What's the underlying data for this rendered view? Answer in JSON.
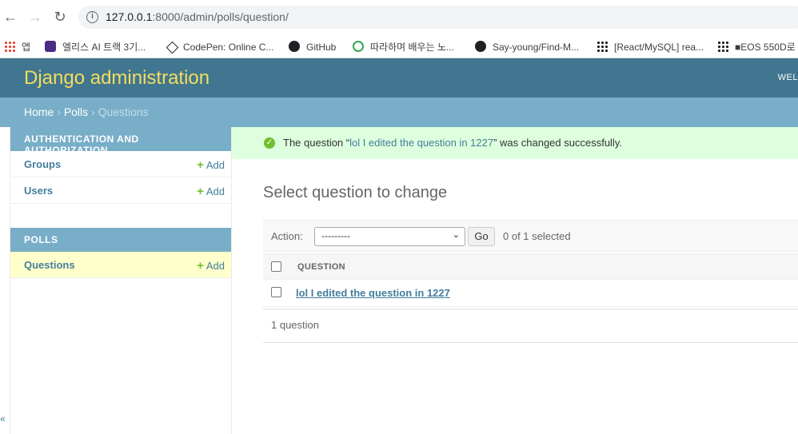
{
  "browser": {
    "url_host": "127.0.0.1",
    "url_rest": ":8000/admin/polls/question/",
    "bookmarks": [
      {
        "label": "앱",
        "icon": "apps-icon"
      },
      {
        "label": "엘리스 AI 트랙 3기...",
        "icon": "elice-icon"
      },
      {
        "label": "CodePen: Online C...",
        "icon": "codepen-icon"
      },
      {
        "label": "GitHub",
        "icon": "github-icon"
      },
      {
        "label": "따라하며 배우는 노...",
        "icon": "globe-icon"
      },
      {
        "label": "Say-young/Find-M...",
        "icon": "github-icon"
      },
      {
        "label": "[React/MySQL] rea...",
        "icon": "dots-icon"
      },
      {
        "label": "■EOS 550D로",
        "icon": "dots-icon"
      }
    ]
  },
  "header": {
    "branding": "Django administration",
    "user_tools": "WEL"
  },
  "breadcrumbs": {
    "home": "Home",
    "sep1": " › ",
    "app": "Polls",
    "sep2": " › ",
    "current": "Questions"
  },
  "sidebar": {
    "modules": [
      {
        "caption": "AUTHENTICATION AND AUTHORIZATION",
        "models": [
          {
            "name": "Groups",
            "add": "Add"
          },
          {
            "name": "Users",
            "add": "Add"
          }
        ]
      },
      {
        "caption": "POLLS",
        "models": [
          {
            "name": "Questions",
            "add": "Add"
          }
        ]
      }
    ],
    "collapse_glyph": "«"
  },
  "message": {
    "prefix": "The question “",
    "link": "lol I edited the question in 1227",
    "suffix": "” was changed successfully."
  },
  "content": {
    "title": "Select question to change",
    "action_label": "Action:",
    "action_selected": "---------",
    "go_label": "Go",
    "counter": "0 of 1 selected",
    "column_header": "QUESTION",
    "rows": [
      "lol I edited the question in 1227"
    ],
    "paginator": "1 question"
  },
  "colors": {
    "header_bg": "#417690",
    "branding": "#f5dd5d",
    "breadcrumbs_bg": "#79aec8",
    "success_bg": "#ddffdd",
    "link": "#447e9b",
    "current_row": "#ffffcc"
  }
}
